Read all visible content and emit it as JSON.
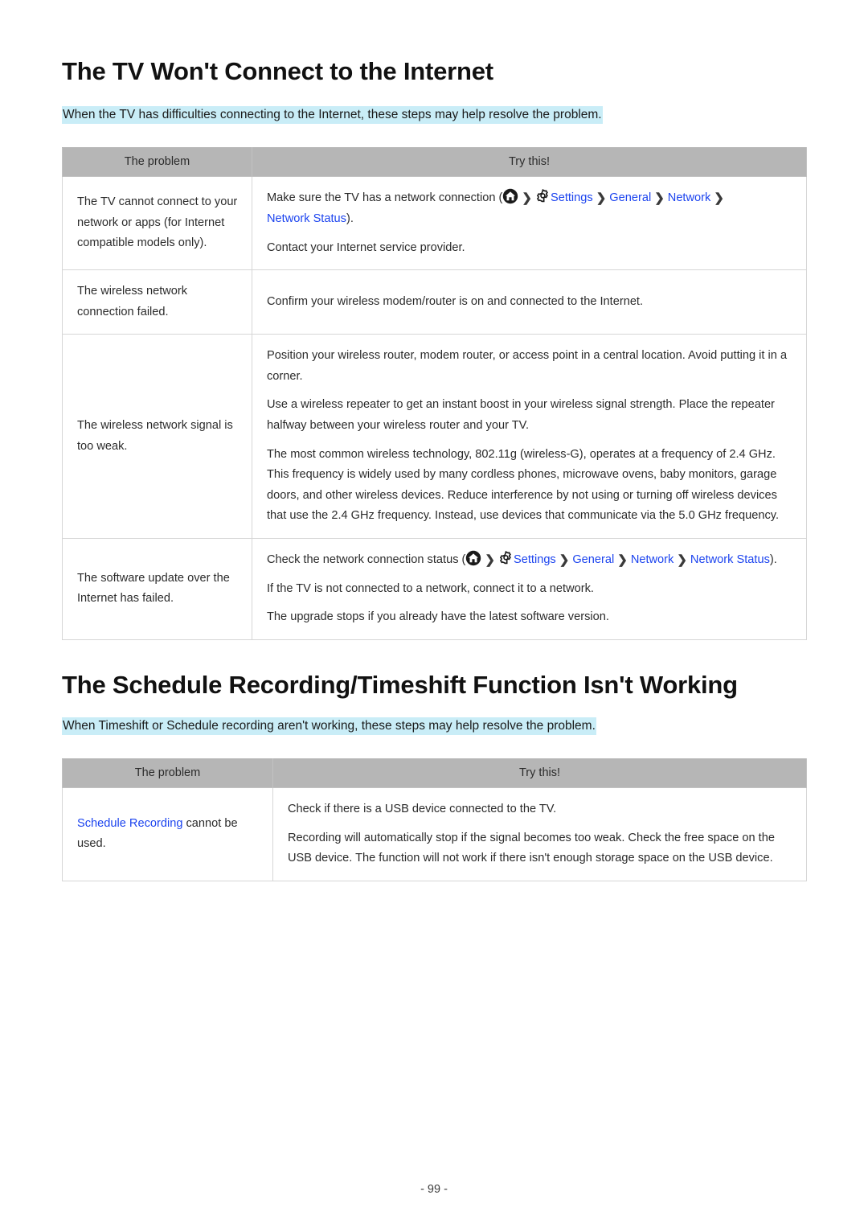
{
  "document": {
    "page_number": "- 99 -"
  },
  "sections": [
    {
      "id": "internet",
      "title": "The TV Won't Connect to the Internet",
      "lead": "When the TV has difficulties connecting to the Internet, these steps may help resolve the problem.",
      "table": {
        "headers": {
          "problem": "The problem",
          "try_this": "Try this!"
        },
        "rows": [
          {
            "problem": "The TV cannot connect to your network or apps (for Internet compatible models only).",
            "answers": {
              "line1_pre": "Make sure the TV has a network connection (",
              "line1_settings": "Settings",
              "line1_general": "General",
              "line1_network": "Network",
              "line1_network_status": "Network Status",
              "line1_post": ").",
              "line2": "Contact your Internet service provider."
            }
          },
          {
            "problem": "The wireless network connection failed.",
            "answers": {
              "line1": "Confirm your wireless modem/router is on and connected to the Internet."
            }
          },
          {
            "problem": "The wireless network signal is too weak.",
            "answers": {
              "line1": "Position your wireless router, modem router, or access point in a central location. Avoid putting it in a corner.",
              "line2": "Use a wireless repeater to get an instant boost in your wireless signal strength. Place the repeater halfway between your wireless router and your TV.",
              "line3": "The most common wireless technology, 802.11g (wireless-G), operates at a frequency of 2.4 GHz. This frequency is widely used by many cordless phones, microwave ovens, baby monitors, garage doors, and other wireless devices. Reduce interference by not using or turning off wireless devices that use the 2.4 GHz frequency. Instead, use devices that communicate via the 5.0 GHz frequency."
            }
          },
          {
            "problem": "The software update over the Internet has failed.",
            "answers": {
              "line1_pre": "Check the network connection status (",
              "line1_settings": "Settings",
              "line1_general": "General",
              "line1_network": "Network",
              "line1_network_status": "Network Status",
              "line1_post": ").",
              "line2": "If the TV is not connected to a network, connect it to a network.",
              "line3": "The upgrade stops if you already have the latest software version."
            }
          }
        ]
      }
    },
    {
      "id": "schedule",
      "title": "The Schedule Recording/Timeshift Function Isn't Working",
      "lead": "When Timeshift or Schedule recording aren't working, these steps may help resolve the problem.",
      "table": {
        "headers": {
          "problem": "The problem",
          "try_this": "Try this!"
        },
        "rows": [
          {
            "problem_link": "Schedule Recording",
            "problem_rest": " cannot be used.",
            "answers": {
              "line1": "Check if there is a USB device connected to the TV.",
              "line2": "Recording will automatically stop if the signal becomes too weak. Check the free space on the USB device. The function will not work if there isn't enough storage space on the USB device."
            }
          }
        ]
      }
    }
  ],
  "icons": {
    "home": "home-icon",
    "gear": "gear-icon",
    "chevron": "chevron-right-icon"
  },
  "colors": {
    "link_blue": "#1c44ef",
    "lead_highlight": "#c9edf7",
    "table_header_gray": "#b6b6b6",
    "text": "#2b2b2b"
  }
}
